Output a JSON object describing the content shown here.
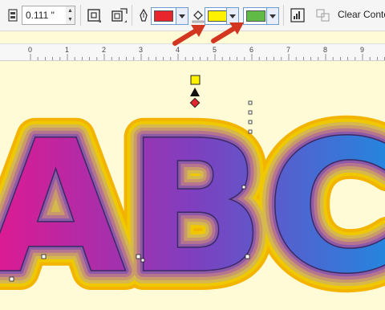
{
  "toolbar": {
    "offset_value": "0.111 \"",
    "clear_label": "Clear Contou",
    "outline_color": "#e8242c",
    "fill_color": "#fff200",
    "end_fill_color": "#5fba46"
  },
  "ruler": {
    "numbers": [
      "0",
      "1",
      "2",
      "3",
      "4",
      "5",
      "6",
      "7",
      "8",
      "9"
    ]
  },
  "artwork": {
    "text": "ABC",
    "gradient_start": "#e2188f",
    "gradient_mid": "#7f3fbf",
    "gradient_end": "#1f8ae0",
    "contour_outer_color": "#ffe000"
  }
}
